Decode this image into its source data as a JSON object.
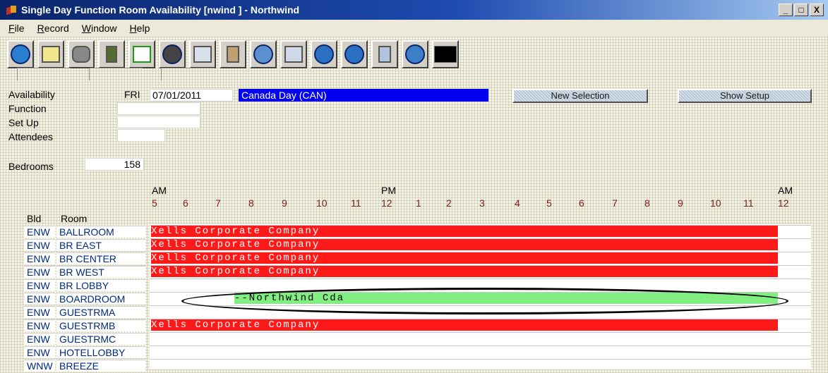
{
  "window": {
    "title": "Single Day Function Room Availability [nwind  ] - Northwind",
    "minimize": "_",
    "maximize": "□",
    "close": "X"
  },
  "menu": [
    "File",
    "Record",
    "Window",
    "Help"
  ],
  "toolbar_icons": [
    "help-icon",
    "notes-icon",
    "binoculars-icon",
    "download-icon",
    "add-icon",
    "delete-icon",
    "chart-icon",
    "person-icon",
    "globe-icon",
    "home-icon",
    "up-icon",
    "down-icon",
    "export-icon",
    "refresh-icon",
    "terminal-icon"
  ],
  "form": {
    "availability_label": "Availability",
    "day": "FRI",
    "date": "07/01/2011",
    "holiday": "Canada Day (CAN)",
    "function_label": "Function",
    "function_value": "",
    "setup_label": "Set Up",
    "setup_value": "",
    "attendees_label": "Attendees",
    "attendees_value": "",
    "bedrooms_label": "Bedrooms",
    "bedrooms_value": "158",
    "new_selection": "New Selection",
    "show_setup": "Show Setup"
  },
  "timeline": {
    "am_label": "AM",
    "pm_label": "PM",
    "am_end_label": "AM",
    "hours": [
      "5",
      "6",
      "7",
      "8",
      "9",
      "10",
      "11",
      "12",
      "1",
      "2",
      "3",
      "4",
      "5",
      "6",
      "7",
      "8",
      "9",
      "10",
      "11",
      "12"
    ]
  },
  "table": {
    "bld_header": "Bld",
    "room_header": "Room",
    "rows": [
      {
        "bld": "ENW",
        "room": "BALLROOM",
        "booking": "Xells Corporate Company",
        "color": "#ff1a1a"
      },
      {
        "bld": "ENW",
        "room": "BR EAST",
        "booking": "Xells Corporate Company",
        "color": "#ff1a1a"
      },
      {
        "bld": "ENW",
        "room": "BR CENTER",
        "booking": "Xells Corporate Company",
        "color": "#ff1a1a"
      },
      {
        "bld": "ENW",
        "room": "BR WEST",
        "booking": "Xells Corporate Company",
        "color": "#ff1a1a"
      },
      {
        "bld": "ENW",
        "room": "BR LOBBY",
        "booking": "",
        "color": ""
      },
      {
        "bld": "ENW",
        "room": "BOARDROOM",
        "booking": "--Northwind Cda",
        "color": "#80ee80"
      },
      {
        "bld": "ENW",
        "room": "GUESTRMA",
        "booking": "",
        "color": ""
      },
      {
        "bld": "ENW",
        "room": "GUESTRMB",
        "booking": "Xells Corporate Company",
        "color": "#ff1a1a"
      },
      {
        "bld": "ENW",
        "room": "GUESTRMC",
        "booking": "",
        "color": ""
      },
      {
        "bld": "ENW",
        "room": "HOTELLOBBY",
        "booking": "",
        "color": ""
      },
      {
        "bld": "WNW",
        "room": "BREEZE",
        "booking": "",
        "color": ""
      }
    ]
  }
}
